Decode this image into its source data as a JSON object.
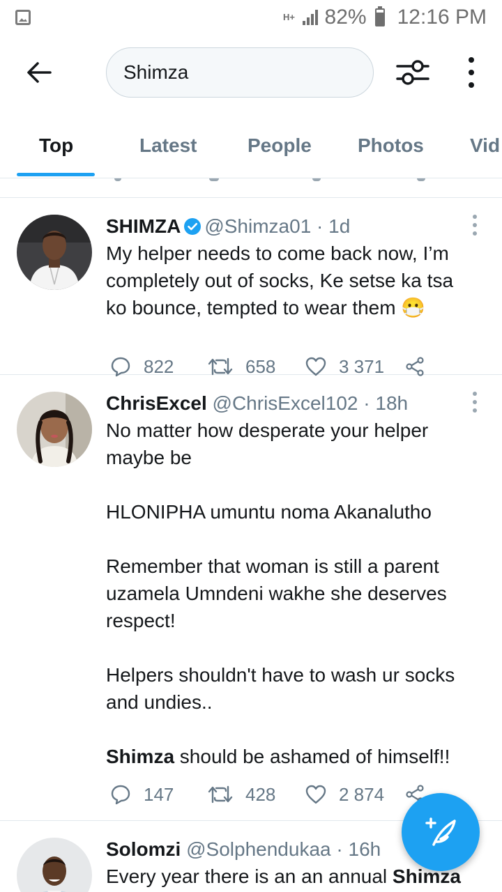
{
  "status_bar": {
    "network": "H+",
    "battery": "82%",
    "time": "12:16 PM"
  },
  "search": {
    "query": "Shimza"
  },
  "tabs": [
    "Top",
    "Latest",
    "People",
    "Photos",
    "Vid"
  ],
  "active_tab": "Top",
  "tweets": [
    {
      "name": "SHIMZA",
      "verified": true,
      "handle": "@Shimza01",
      "time": "· 1d",
      "text": "My helper needs to come back now, I’m completely out of socks, Ke setse ka tsa ko bounce, tempted to wear them 😷",
      "replies": "822",
      "retweets": "658",
      "likes": "3 371"
    },
    {
      "name": "ChrisExcel",
      "verified": false,
      "handle": "@ChrisExcel102",
      "time": "· 18h",
      "text_lines": [
        "No matter how desperate your helper maybe be",
        "",
        "HLONIPHA umuntu noma Akanalutho",
        "",
        "Remember that woman is still a parent uzamela Umndeni wakhe she deserves respect!",
        "",
        "Helpers shouldn't have to wash ur socks and undies..",
        ""
      ],
      "last_line_bold": "Shimza",
      "last_line_rest": " should be ashamed of himself!!",
      "replies": "147",
      "retweets": "428",
      "likes": "2 874"
    },
    {
      "name": "Solomzi",
      "verified": false,
      "handle": "@Solphendukaa",
      "time": "· 16h",
      "text_start": "Every year there is an an annual ",
      "text_bold": "Shimza"
    }
  ],
  "colors": {
    "accent": "#1da1f2",
    "text_primary": "#14171a",
    "text_secondary": "#657786",
    "divider": "#e1e8ed"
  },
  "icons": {
    "back": "arrow-left-icon",
    "filter": "sliders-icon",
    "more": "vertical-dots-icon",
    "reply": "reply-icon",
    "retweet": "retweet-icon",
    "like": "heart-icon",
    "share": "share-icon",
    "compose": "compose-tweet-icon"
  }
}
